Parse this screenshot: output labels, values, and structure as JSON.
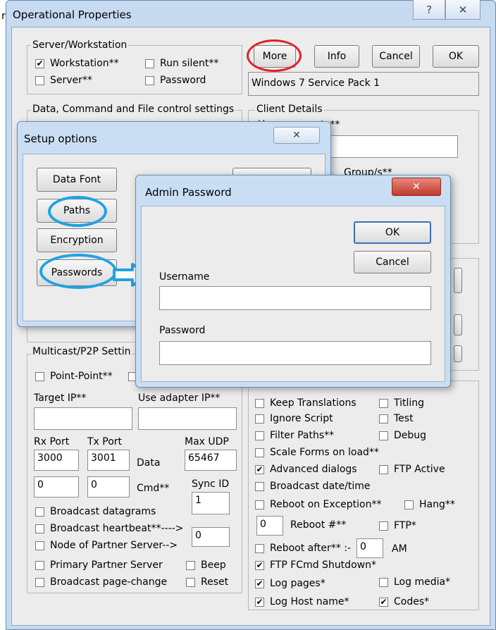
{
  "main_window": {
    "title": "Operational Properties",
    "help_glyph": "?",
    "close_glyph": "✕",
    "left_edge_fragment": "r",
    "server_workstation": {
      "label": "Server/Workstation",
      "workstation": "Workstation**",
      "workstation_checked": true,
      "run_silent": "Run silent**",
      "server": "Server**",
      "password": "Password"
    },
    "buttons": {
      "more": "More",
      "info": "Info",
      "cancel": "Cancel",
      "ok": "OK"
    },
    "os_version": "Windows 7 Service Pack 1",
    "data_settings_label": "Data, Command and File control settings",
    "client_details": {
      "label": "Client Details",
      "field_label_partial": "User name etc**",
      "groups_label": "Group/s**"
    },
    "multicast": {
      "label": "Multicast/P2P Settin",
      "point_point": "Point-Point**",
      "target_ip_label": "Target IP**",
      "use_adapter_label": "Use adapter IP**",
      "rx_port_label": "Rx Port",
      "tx_port_label": "Tx Port",
      "max_udp_label": "Max UDP",
      "rx_port": "3000",
      "tx_port": "3001",
      "data_label": "Data",
      "max_udp": "65467",
      "cmd_rx": "0",
      "cmd_tx": "0",
      "cmd_label": "Cmd**",
      "sync_id_label": "Sync ID",
      "sync_id": "1",
      "broadcast_datagrams": "Broadcast datagrams",
      "broadcast_heartbeat": "Broadcast heartbeat**---->",
      "heartbeat_value": "0",
      "node_partner": "Node of Partner Server-->",
      "primary_partner": "Primary Partner Server",
      "beep": "Beep",
      "broadcast_page_change": "Broadcast page-change",
      "reset": "Reset"
    },
    "options": {
      "keep_translations": "Keep Translations",
      "titling": "Titling",
      "ignore_script": "Ignore Script",
      "test": "Test",
      "filter_paths": "Filter Paths**",
      "debug": "Debug",
      "scale_forms": "Scale Forms on load**",
      "advanced_dialogs": "Advanced dialogs",
      "advanced_dialogs_checked": true,
      "ftp_active": "FTP Active",
      "broadcast_datetime": "Broadcast date/time",
      "reboot_on_exception": "Reboot on Exception**",
      "hang": "Hang**",
      "reboot_num_value": "0",
      "reboot_num": "Reboot #**",
      "ftp": "FTP*",
      "reboot_after": "Reboot after** :-",
      "reboot_after_value": "0",
      "am": "AM",
      "ftp_fcmd": "FTP FCmd Shutdown*",
      "ftp_fcmd_checked": true,
      "log_pages": "Log pages*",
      "log_pages_checked": true,
      "log_media": "Log media*",
      "log_host": "Log Host name*",
      "log_host_checked": true,
      "codes": "Codes*",
      "codes_checked": true
    }
  },
  "setup_dialog": {
    "title": "Setup options",
    "close_glyph": "✕",
    "data_font": "Data Font",
    "paths": "Paths",
    "encryption": "Encryption",
    "passwords": "Passwords"
  },
  "admin_dialog": {
    "title": "Admin Password",
    "close_glyph": "✕",
    "ok": "OK",
    "cancel": "Cancel",
    "username_label": "Username",
    "username_value": "",
    "password_label": "Password",
    "password_value": ""
  },
  "colors": {
    "annotation_red": "#e0202a",
    "annotation_blue": "#1fa3e3",
    "close_red": "#c9473a",
    "titlebar": "#c6daf0"
  },
  "icons": {
    "arrow_annotation": "right-arrow-icon",
    "check": "check-icon"
  }
}
